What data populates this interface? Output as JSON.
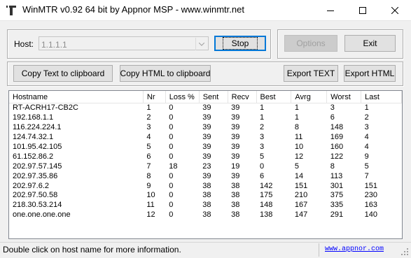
{
  "window": {
    "title": "WinMTR v0.92 64 bit by Appnor MSP - www.winmtr.net",
    "icon": "winmtr-app-icon",
    "controls": [
      "minimize-icon",
      "maximize-icon",
      "close-icon"
    ]
  },
  "host": {
    "label": "Host:",
    "value": "1.1.1.1"
  },
  "buttons": {
    "stop_label": "Stop",
    "options_label": "Options",
    "exit_label": "Exit",
    "copy_text_label": "Copy Text to clipboard",
    "copy_html_label": "Copy HTML to clipboard",
    "export_text_label": "Export TEXT",
    "export_html_label": "Export HTML"
  },
  "table": {
    "columns": [
      "Hostname",
      "Nr",
      "Loss %",
      "Sent",
      "Recv",
      "Best",
      "Avrg",
      "Worst",
      "Last"
    ],
    "rows": [
      [
        "RT-ACRH17-CB2C",
        "1",
        "0",
        "39",
        "39",
        "1",
        "1",
        "3",
        "1"
      ],
      [
        "192.168.1.1",
        "2",
        "0",
        "39",
        "39",
        "1",
        "1",
        "6",
        "2"
      ],
      [
        "116.224.224.1",
        "3",
        "0",
        "39",
        "39",
        "2",
        "8",
        "148",
        "3"
      ],
      [
        "124.74.32.1",
        "4",
        "0",
        "39",
        "39",
        "3",
        "11",
        "169",
        "4"
      ],
      [
        "101.95.42.105",
        "5",
        "0",
        "39",
        "39",
        "3",
        "10",
        "160",
        "4"
      ],
      [
        "61.152.86.2",
        "6",
        "0",
        "39",
        "39",
        "5",
        "12",
        "122",
        "9"
      ],
      [
        "202.97.57.145",
        "7",
        "18",
        "23",
        "19",
        "0",
        "5",
        "8",
        "5"
      ],
      [
        "202.97.35.86",
        "8",
        "0",
        "39",
        "39",
        "6",
        "14",
        "113",
        "7"
      ],
      [
        "202.97.6.2",
        "9",
        "0",
        "38",
        "38",
        "142",
        "151",
        "301",
        "151"
      ],
      [
        "202.97.50.58",
        "10",
        "0",
        "38",
        "38",
        "175",
        "210",
        "375",
        "230"
      ],
      [
        "218.30.53.214",
        "11",
        "0",
        "38",
        "38",
        "148",
        "167",
        "335",
        "163"
      ],
      [
        "one.one.one.one",
        "12",
        "0",
        "38",
        "38",
        "138",
        "147",
        "291",
        "140"
      ]
    ]
  },
  "statusbar": {
    "text": "Double click on host name for more information.",
    "link": "www.appnor.com"
  }
}
